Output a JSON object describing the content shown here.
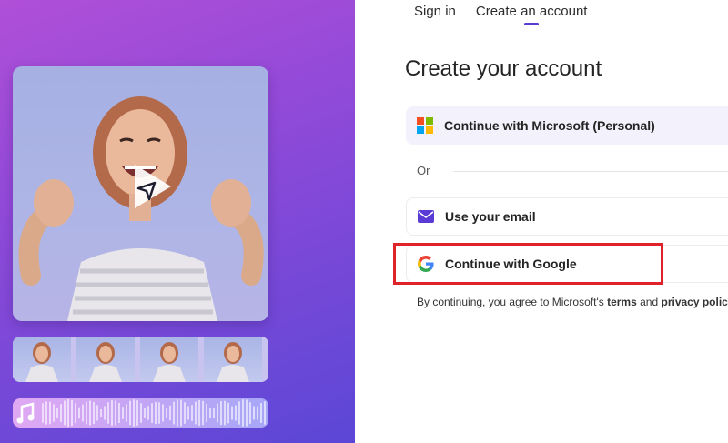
{
  "tabs": [
    {
      "label": "Sign in",
      "active": false
    },
    {
      "label": "Create an account",
      "active": true
    }
  ],
  "heading": "Create your account",
  "options": {
    "microsoft": {
      "label": "Continue with Microsoft (Personal)",
      "icon": "microsoft-logo-icon"
    },
    "email": {
      "label": "Use your email",
      "icon": "envelope-icon"
    },
    "google": {
      "label": "Continue with Google",
      "icon": "google-logo-icon"
    }
  },
  "or_label": "Or",
  "terms": {
    "prefix": "By continuing, you agree to Microsoft's",
    "terms_link": "terms",
    "and": "and",
    "privacy_link": "privacy polic"
  },
  "promo": {
    "video_icon": "play-icon",
    "audio_icon": "music-note-icon"
  },
  "colors": {
    "accent": "#5a3bd6",
    "highlight": "#e0232a",
    "panel_start": "#b04fd8",
    "panel_end": "#5b47d6"
  }
}
